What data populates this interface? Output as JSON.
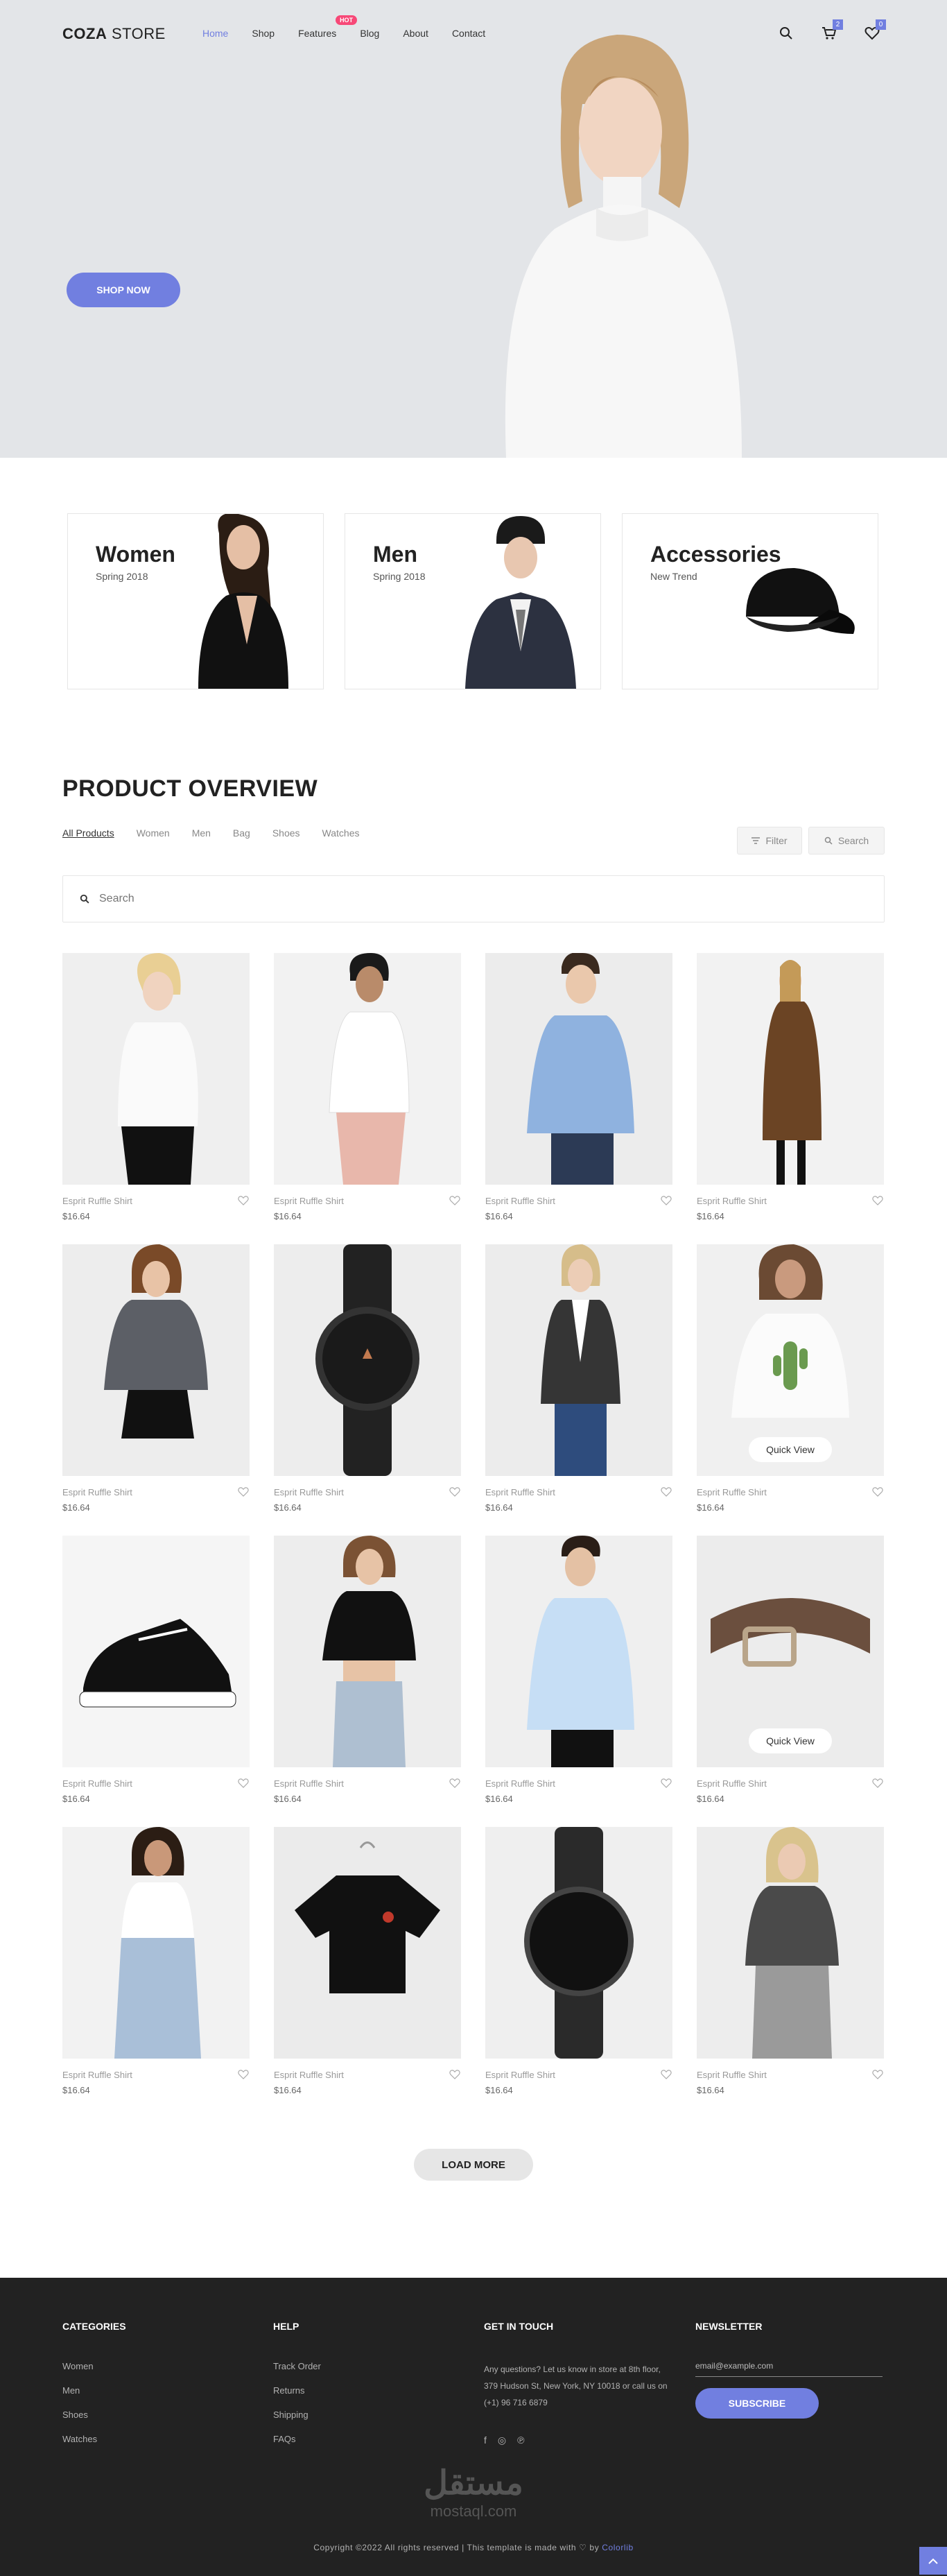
{
  "header": {
    "logo_bold": "COZA",
    "logo_rest": " STORE",
    "nav": [
      {
        "label": "Home",
        "active": true
      },
      {
        "label": "Shop"
      },
      {
        "label": "Features",
        "badge": "HOT"
      },
      {
        "label": "Blog"
      },
      {
        "label": "About"
      },
      {
        "label": "Contact"
      }
    ],
    "cart_count": "2",
    "wishlist_count": "0"
  },
  "hero": {
    "button_label": "SHOP NOW"
  },
  "banners": [
    {
      "title": "Women",
      "subtitle": "Spring 2018"
    },
    {
      "title": "Men",
      "subtitle": "Spring 2018"
    },
    {
      "title": "Accessories",
      "subtitle": "New Trend"
    }
  ],
  "overview": {
    "title": "PRODUCT OVERVIEW",
    "filters": [
      "All Products",
      "Women",
      "Men",
      "Bag",
      "Shoes",
      "Watches"
    ],
    "filter_button": "Filter",
    "search_button": "Search",
    "search_placeholder": "Search"
  },
  "products": [
    {
      "name": "Esprit Ruffle Shirt",
      "price": "$16.64",
      "icon": "woman-white-tee"
    },
    {
      "name": "Esprit Ruffle Shirt",
      "price": "$16.64",
      "icon": "woman-white-shirt"
    },
    {
      "name": "Esprit Ruffle Shirt",
      "price": "$16.64",
      "icon": "man-blue-shirt"
    },
    {
      "name": "Esprit Ruffle Shirt",
      "price": "$16.64",
      "icon": "woman-brown-coat"
    },
    {
      "name": "Esprit Ruffle Shirt",
      "price": "$16.64",
      "icon": "woman-grey-shirt"
    },
    {
      "name": "Esprit Ruffle Shirt",
      "price": "$16.64",
      "icon": "black-watch"
    },
    {
      "name": "Esprit Ruffle Shirt",
      "price": "$16.64",
      "icon": "woman-blazer"
    },
    {
      "name": "Esprit Ruffle Shirt",
      "price": "$16.64",
      "icon": "woman-cactus-tee",
      "quick_view": "Quick View"
    },
    {
      "name": "Esprit Ruffle Shirt",
      "price": "$16.64",
      "icon": "sneaker"
    },
    {
      "name": "Esprit Ruffle Shirt",
      "price": "$16.64",
      "icon": "woman-black-crop"
    },
    {
      "name": "Esprit Ruffle Shirt",
      "price": "$16.64",
      "icon": "man-light-shirt"
    },
    {
      "name": "Esprit Ruffle Shirt",
      "price": "$16.64",
      "icon": "leather-belt",
      "quick_view": "Quick View"
    },
    {
      "name": "Esprit Ruffle Shirt",
      "price": "$16.64",
      "icon": "woman-jeans"
    },
    {
      "name": "Esprit Ruffle Shirt",
      "price": "$16.64",
      "icon": "black-tee"
    },
    {
      "name": "Esprit Ruffle Shirt",
      "price": "$16.64",
      "icon": "dark-watch"
    },
    {
      "name": "Esprit Ruffle Shirt",
      "price": "$16.64",
      "icon": "woman-grey-tee"
    }
  ],
  "load_more": "LOAD MORE",
  "footer": {
    "categories": {
      "title": "CATEGORIES",
      "items": [
        "Women",
        "Men",
        "Shoes",
        "Watches"
      ]
    },
    "help": {
      "title": "HELP",
      "items": [
        "Track Order",
        "Returns",
        "Shipping",
        "FAQs"
      ]
    },
    "touch": {
      "title": "GET IN TOUCH",
      "text": "Any questions? Let us know in store at 8th floor, 379 Hudson St, New York, NY 10018 or call us on (+1) 96 716 6879"
    },
    "newsletter": {
      "title": "NEWSLETTER",
      "placeholder": "email@example.com",
      "button": "SUBSCRIBE"
    },
    "watermark_ar": "مستقل",
    "watermark_en": "mostaql.com",
    "copyright": "Copyright ©2022 All rights reserved | This template is made with ♡ by ",
    "copyright_link": "Colorlib"
  },
  "colors": {
    "accent": "#717fe0",
    "hot": "#f74877",
    "footer_bg": "#222222"
  }
}
